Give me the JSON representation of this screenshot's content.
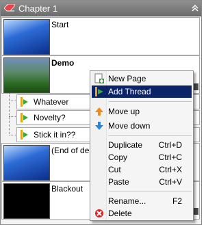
{
  "header": {
    "title": "Chapter 1"
  },
  "scenes": [
    {
      "name": "Start"
    },
    {
      "name": "Demo"
    },
    {
      "name": "(End of de"
    },
    {
      "name": "Blackout"
    }
  ],
  "threads": [
    {
      "label": "Whatever"
    },
    {
      "label": "Novelty?"
    },
    {
      "label": "Stick it in??"
    }
  ],
  "menu": {
    "new_page": "New Page",
    "add_thread": "Add Thread",
    "move_up": "Move up",
    "move_down": "Move down",
    "duplicate": "Duplicate",
    "duplicate_sc": "Ctrl+D",
    "copy": "Copy",
    "copy_sc": "Ctrl+C",
    "cut": "Cut",
    "cut_sc": "Ctrl+X",
    "paste": "Paste",
    "paste_sc": "Ctrl+V",
    "rename": "Rename...",
    "rename_sc": "F2",
    "delete": "Delete"
  },
  "colors": {
    "menu_highlight": "#0a2467",
    "header_bg": "#7a7a7a"
  }
}
